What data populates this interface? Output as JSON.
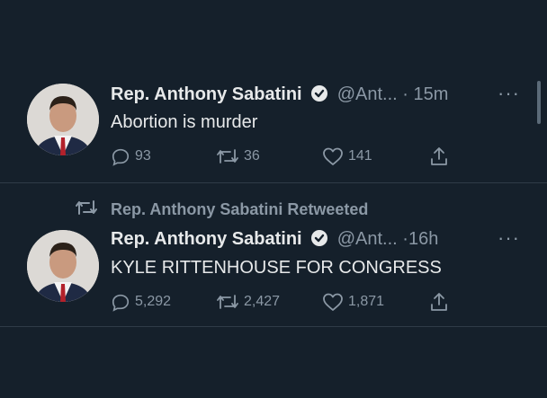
{
  "tweets": [
    {
      "name": "Rep. Anthony Sabatini",
      "handle": "@Ant...",
      "time": "· 15m",
      "text": "Abortion is murder",
      "replies": "93",
      "retweets": "36",
      "likes": "141"
    },
    {
      "retweet_note": "Rep. Anthony Sabatini Retweeted",
      "name": "Rep. Anthony Sabatini",
      "handle": "@Ant...",
      "time": "·16h",
      "text": "KYLE RITTENHOUSE FOR CONGRESS",
      "replies": "5,292",
      "retweets": "2,427",
      "likes": "1,871"
    }
  ],
  "icons": [
    "verified-badge-icon",
    "more-icon",
    "reply-icon",
    "retweet-icon",
    "like-icon",
    "share-icon"
  ],
  "colors": {
    "background": "#15202b",
    "text": "#e7e9ea",
    "muted": "#8b98a5",
    "divider": "#2f3b47"
  }
}
